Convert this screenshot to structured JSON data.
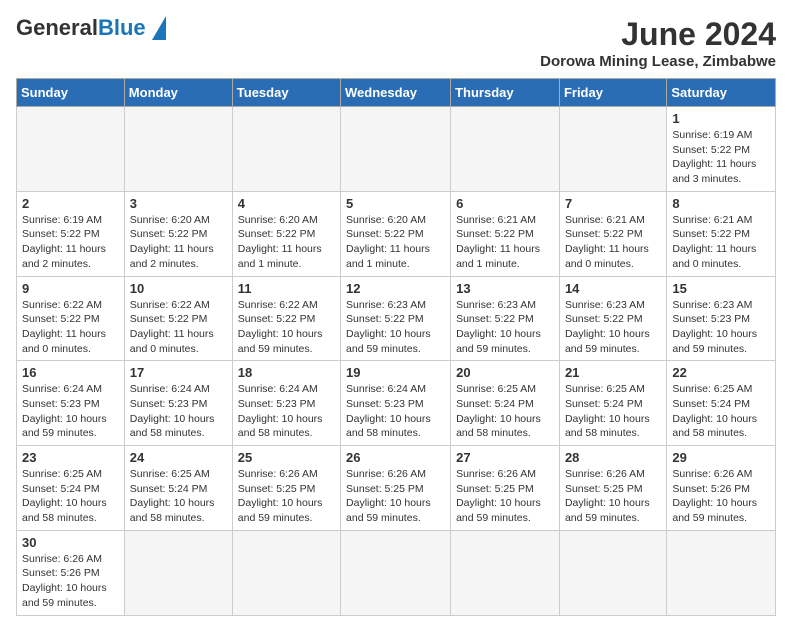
{
  "header": {
    "logo_general": "General",
    "logo_blue": "Blue",
    "month_year": "June 2024",
    "location": "Dorowa Mining Lease, Zimbabwe"
  },
  "days_of_week": [
    "Sunday",
    "Monday",
    "Tuesday",
    "Wednesday",
    "Thursday",
    "Friday",
    "Saturday"
  ],
  "weeks": [
    {
      "days": [
        {
          "number": "",
          "info": ""
        },
        {
          "number": "",
          "info": ""
        },
        {
          "number": "",
          "info": ""
        },
        {
          "number": "",
          "info": ""
        },
        {
          "number": "",
          "info": ""
        },
        {
          "number": "",
          "info": ""
        },
        {
          "number": "1",
          "info": "Sunrise: 6:19 AM\nSunset: 5:22 PM\nDaylight: 11 hours\nand 3 minutes."
        }
      ]
    },
    {
      "days": [
        {
          "number": "2",
          "info": "Sunrise: 6:19 AM\nSunset: 5:22 PM\nDaylight: 11 hours\nand 2 minutes."
        },
        {
          "number": "3",
          "info": "Sunrise: 6:20 AM\nSunset: 5:22 PM\nDaylight: 11 hours\nand 2 minutes."
        },
        {
          "number": "4",
          "info": "Sunrise: 6:20 AM\nSunset: 5:22 PM\nDaylight: 11 hours\nand 1 minute."
        },
        {
          "number": "5",
          "info": "Sunrise: 6:20 AM\nSunset: 5:22 PM\nDaylight: 11 hours\nand 1 minute."
        },
        {
          "number": "6",
          "info": "Sunrise: 6:21 AM\nSunset: 5:22 PM\nDaylight: 11 hours\nand 1 minute."
        },
        {
          "number": "7",
          "info": "Sunrise: 6:21 AM\nSunset: 5:22 PM\nDaylight: 11 hours\nand 0 minutes."
        },
        {
          "number": "8",
          "info": "Sunrise: 6:21 AM\nSunset: 5:22 PM\nDaylight: 11 hours\nand 0 minutes."
        }
      ]
    },
    {
      "days": [
        {
          "number": "9",
          "info": "Sunrise: 6:22 AM\nSunset: 5:22 PM\nDaylight: 11 hours\nand 0 minutes."
        },
        {
          "number": "10",
          "info": "Sunrise: 6:22 AM\nSunset: 5:22 PM\nDaylight: 11 hours\nand 0 minutes."
        },
        {
          "number": "11",
          "info": "Sunrise: 6:22 AM\nSunset: 5:22 PM\nDaylight: 10 hours\nand 59 minutes."
        },
        {
          "number": "12",
          "info": "Sunrise: 6:23 AM\nSunset: 5:22 PM\nDaylight: 10 hours\nand 59 minutes."
        },
        {
          "number": "13",
          "info": "Sunrise: 6:23 AM\nSunset: 5:22 PM\nDaylight: 10 hours\nand 59 minutes."
        },
        {
          "number": "14",
          "info": "Sunrise: 6:23 AM\nSunset: 5:22 PM\nDaylight: 10 hours\nand 59 minutes."
        },
        {
          "number": "15",
          "info": "Sunrise: 6:23 AM\nSunset: 5:23 PM\nDaylight: 10 hours\nand 59 minutes."
        }
      ]
    },
    {
      "days": [
        {
          "number": "16",
          "info": "Sunrise: 6:24 AM\nSunset: 5:23 PM\nDaylight: 10 hours\nand 59 minutes."
        },
        {
          "number": "17",
          "info": "Sunrise: 6:24 AM\nSunset: 5:23 PM\nDaylight: 10 hours\nand 58 minutes."
        },
        {
          "number": "18",
          "info": "Sunrise: 6:24 AM\nSunset: 5:23 PM\nDaylight: 10 hours\nand 58 minutes."
        },
        {
          "number": "19",
          "info": "Sunrise: 6:24 AM\nSunset: 5:23 PM\nDaylight: 10 hours\nand 58 minutes."
        },
        {
          "number": "20",
          "info": "Sunrise: 6:25 AM\nSunset: 5:24 PM\nDaylight: 10 hours\nand 58 minutes."
        },
        {
          "number": "21",
          "info": "Sunrise: 6:25 AM\nSunset: 5:24 PM\nDaylight: 10 hours\nand 58 minutes."
        },
        {
          "number": "22",
          "info": "Sunrise: 6:25 AM\nSunset: 5:24 PM\nDaylight: 10 hours\nand 58 minutes."
        }
      ]
    },
    {
      "days": [
        {
          "number": "23",
          "info": "Sunrise: 6:25 AM\nSunset: 5:24 PM\nDaylight: 10 hours\nand 58 minutes."
        },
        {
          "number": "24",
          "info": "Sunrise: 6:25 AM\nSunset: 5:24 PM\nDaylight: 10 hours\nand 58 minutes."
        },
        {
          "number": "25",
          "info": "Sunrise: 6:26 AM\nSunset: 5:25 PM\nDaylight: 10 hours\nand 59 minutes."
        },
        {
          "number": "26",
          "info": "Sunrise: 6:26 AM\nSunset: 5:25 PM\nDaylight: 10 hours\nand 59 minutes."
        },
        {
          "number": "27",
          "info": "Sunrise: 6:26 AM\nSunset: 5:25 PM\nDaylight: 10 hours\nand 59 minutes."
        },
        {
          "number": "28",
          "info": "Sunrise: 6:26 AM\nSunset: 5:25 PM\nDaylight: 10 hours\nand 59 minutes."
        },
        {
          "number": "29",
          "info": "Sunrise: 6:26 AM\nSunset: 5:26 PM\nDaylight: 10 hours\nand 59 minutes."
        }
      ]
    },
    {
      "days": [
        {
          "number": "30",
          "info": "Sunrise: 6:26 AM\nSunset: 5:26 PM\nDaylight: 10 hours\nand 59 minutes."
        },
        {
          "number": "",
          "info": ""
        },
        {
          "number": "",
          "info": ""
        },
        {
          "number": "",
          "info": ""
        },
        {
          "number": "",
          "info": ""
        },
        {
          "number": "",
          "info": ""
        },
        {
          "number": "",
          "info": ""
        }
      ]
    }
  ]
}
